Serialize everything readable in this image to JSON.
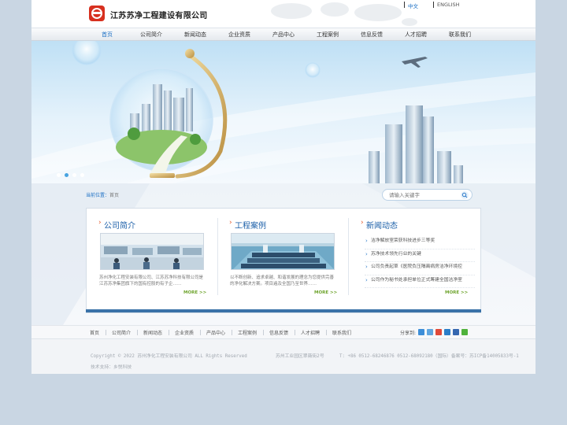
{
  "header": {
    "company_name": "江苏苏净工程建设有限公司",
    "lang_cn": "中文",
    "lang_en": "ENGLISH"
  },
  "nav": {
    "items": [
      {
        "label": "首页",
        "active": true
      },
      {
        "label": "公司简介"
      },
      {
        "label": "新闻动态"
      },
      {
        "label": "企业资质"
      },
      {
        "label": "产品中心"
      },
      {
        "label": "工程案例"
      },
      {
        "label": "信息反馈"
      },
      {
        "label": "人才招聘"
      },
      {
        "label": "联系我们"
      }
    ]
  },
  "location": {
    "prefix": "当前位置：",
    "current": "首页"
  },
  "search": {
    "placeholder": "请输入关键字"
  },
  "sections": {
    "about": {
      "title": "公司简介",
      "text": "苏州净化工程安装有限公司、江苏苏净科技有限公司是江苏苏净集团旗下的国有控股的有子企……",
      "more": "MORE >>"
    },
    "cases": {
      "title": "工程案例",
      "text": "以不断创新、追求卓越、和谐发展的理念为您提供完善的净化解决方案。项目遍及全国乃至世界……",
      "more": "MORE >>"
    },
    "news": {
      "title": "新闻动态",
      "items": [
        "洁净解放室荣获科技进步三等奖",
        "苏净技术领先行业的关键",
        "公司负责起草《医院负压隔离病房洁净环境控",
        "公司作为秘书处承担单位正式筹建全国洁净室"
      ],
      "more": "MORE >>"
    }
  },
  "footer_nav": {
    "items": [
      "首页",
      "公司简介",
      "新闻动态",
      "企业资质",
      "产品中心",
      "工程案例",
      "信息反馈",
      "人才招聘",
      "联系我们"
    ],
    "share_label": "分享到:"
  },
  "footer": {
    "copyright": "Copyright © 2022  苏州净化工程安装有限公司  ALL Rights Reserved",
    "address": "苏州工业园区翠薇街2号",
    "phone": "T: +86 0512-68246876 0512-68092180（国际）备案号：苏ICP备14005833号-1",
    "support": "技术支持：乡悦科技"
  },
  "colors": {
    "accent": "#1b6fc4",
    "brand_red": "#d7301f",
    "more_green": "#6fa42e",
    "panel_bar": "#3a72a8"
  }
}
